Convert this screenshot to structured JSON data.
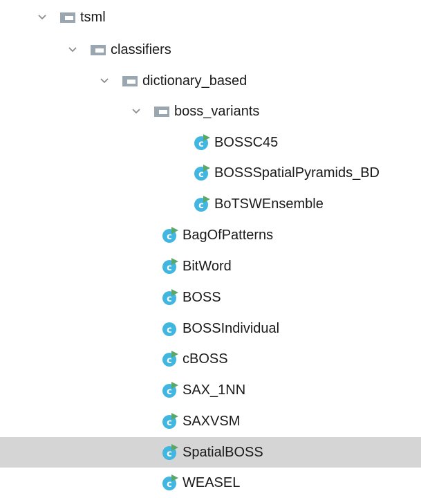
{
  "tree": {
    "root": {
      "label": "tsml",
      "expanded": true
    },
    "classifiers": {
      "label": "classifiers",
      "expanded": true
    },
    "dictionary_based": {
      "label": "dictionary_based",
      "expanded": true
    },
    "boss_variants": {
      "label": "boss_variants",
      "expanded": true,
      "classes": [
        {
          "label": "BOSSC45",
          "runnable": true
        },
        {
          "label": "BOSSSpatialPyramids_BD",
          "runnable": true
        },
        {
          "label": "BoTSWEnsemble",
          "runnable": true
        }
      ]
    },
    "classes": [
      {
        "label": "BagOfPatterns",
        "runnable": true,
        "selected": false
      },
      {
        "label": "BitWord",
        "runnable": true,
        "selected": false
      },
      {
        "label": "BOSS",
        "runnable": true,
        "selected": false
      },
      {
        "label": "BOSSIndividual",
        "runnable": false,
        "selected": false
      },
      {
        "label": "cBOSS",
        "runnable": true,
        "selected": false
      },
      {
        "label": "SAX_1NN",
        "runnable": true,
        "selected": false
      },
      {
        "label": "SAXVSM",
        "runnable": true,
        "selected": false
      },
      {
        "label": "SpatialBOSS",
        "runnable": true,
        "selected": true
      },
      {
        "label": "WEASEL",
        "runnable": true,
        "selected": false
      }
    ]
  },
  "colors": {
    "selection": "#d5d5d5",
    "folder": "#9aa7b0",
    "class_icon": "#40b6e0",
    "run_marker": "#59a869",
    "chevron": "#8c8c8c"
  },
  "icons": {
    "chevron": "chevron-down-icon",
    "folder": "folder-icon",
    "class": "class-icon"
  }
}
